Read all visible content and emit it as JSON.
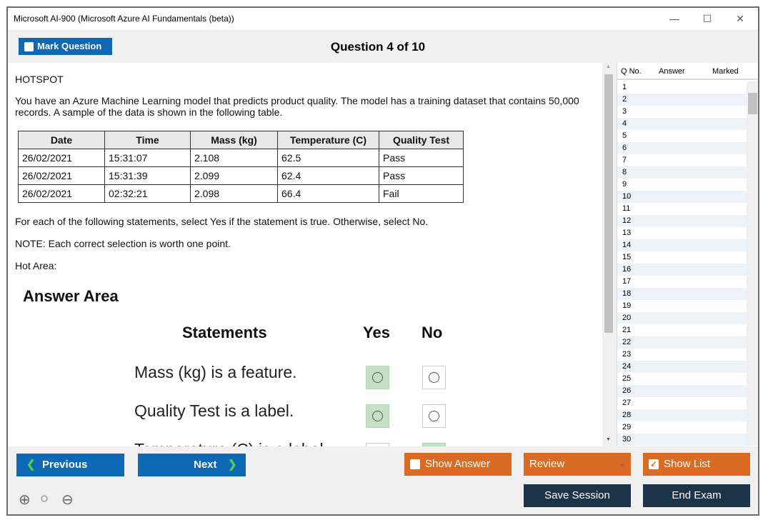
{
  "window": {
    "title": "Microsoft AI-900 (Microsoft Azure AI Fundamentals (beta))",
    "minimize": "—",
    "maximize": "☐",
    "close": "✕"
  },
  "toolbar": {
    "mark_label": "Mark Question",
    "question_title": "Question 4 of 10"
  },
  "question": {
    "type": "HOTSPOT",
    "intro": "You have an Azure Machine Learning model that predicts product quality. The model has a training dataset that contains 50,000 records. A sample of the data is shown in the following table.",
    "table": {
      "headers": [
        "Date",
        "Time",
        "Mass (kg)",
        "Temperature (C)",
        "Quality Test"
      ],
      "rows": [
        [
          "26/02/2021",
          "15:31:07",
          "2.108",
          "62.5",
          "Pass"
        ],
        [
          "26/02/2021",
          "15:31:39",
          "2.099",
          "62.4",
          "Pass"
        ],
        [
          "26/02/2021",
          "02:32:21",
          "2.098",
          "66.4",
          "Fail"
        ]
      ]
    },
    "instruction": "For each of the following statements, select Yes if the statement is true. Otherwise, select No.",
    "note": "NOTE: Each correct selection is worth one point.",
    "hot_area": "Hot Area:",
    "answer_area": {
      "title": "Answer Area",
      "col_statements": "Statements",
      "col_yes": "Yes",
      "col_no": "No",
      "statements": [
        {
          "text": "Mass (kg) is a feature.",
          "selected": "Yes"
        },
        {
          "text": "Quality Test is a label.",
          "selected": "Yes"
        },
        {
          "text": "Temperature (C) is a label.",
          "selected": "No"
        }
      ]
    }
  },
  "list": {
    "headers": [
      "Q No.",
      "Answer",
      "Marked"
    ],
    "rows": [
      "1",
      "2",
      "3",
      "4",
      "5",
      "6",
      "7",
      "8",
      "9",
      "10",
      "11",
      "12",
      "13",
      "14",
      "15",
      "16",
      "17",
      "18",
      "19",
      "20",
      "21",
      "22",
      "23",
      "24",
      "25",
      "26",
      "27",
      "28",
      "29",
      "30"
    ]
  },
  "bottom": {
    "previous": "Previous",
    "next": "Next",
    "show_answer": "Show Answer",
    "review": "Review",
    "show_list": "Show List",
    "save_session": "Save Session",
    "end_exam": "End Exam",
    "show_list_checked": true
  },
  "colors": {
    "blue": "#0f68b3",
    "orange": "#d96b23",
    "navy": "#1c3349",
    "selected_green": "#c6e0c6"
  }
}
